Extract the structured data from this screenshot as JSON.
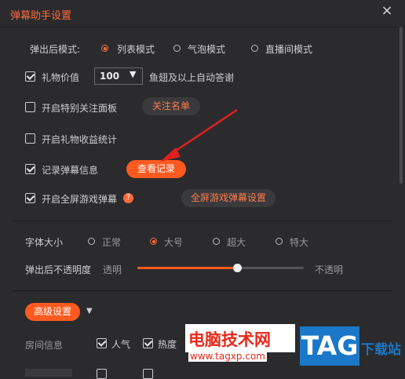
{
  "window": {
    "title": "弹幕助手设置"
  },
  "popup_mode": {
    "label": "弹出后模式:",
    "options": [
      "列表模式",
      "气泡模式",
      "直播间模式"
    ],
    "selected": "列表模式"
  },
  "gift_value": {
    "label": "礼物价值",
    "checked": true,
    "select_value": "100",
    "suffix": "鱼翅及以上自动答谢"
  },
  "special_follow": {
    "label": "开启特别关注面板",
    "checked": false,
    "button": "关注名单"
  },
  "gift_income": {
    "label": "开启礼物收益统计",
    "checked": false
  },
  "record_danmaku": {
    "label": "记录弹幕信息",
    "checked": true,
    "button": "查看记录"
  },
  "fullscreen_game": {
    "label": "开启全屏游戏弹幕",
    "checked": true,
    "help": "?",
    "button": "全屏游戏弹幕设置"
  },
  "font_size": {
    "label": "字体大小",
    "options": [
      "正常",
      "大号",
      "超大",
      "特大"
    ],
    "selected": "大号"
  },
  "opacity": {
    "label": "弹出后不透明度",
    "left": "透明",
    "right": "不透明",
    "value": 0.6
  },
  "advanced": {
    "button": "高级设置"
  },
  "room_info": {
    "label": "房间信息",
    "items": [
      {
        "label": "人气",
        "checked": true
      },
      {
        "label": "热度",
        "checked": true
      }
    ]
  },
  "watermark": {
    "site_name": "电脑技术网",
    "url": "www.tagxp.com",
    "logo": "TAG",
    "suffix": "下载站"
  },
  "colors": {
    "accent": "#ff5a1f",
    "background": "#2b2b2e",
    "arrow": "#e02020"
  }
}
